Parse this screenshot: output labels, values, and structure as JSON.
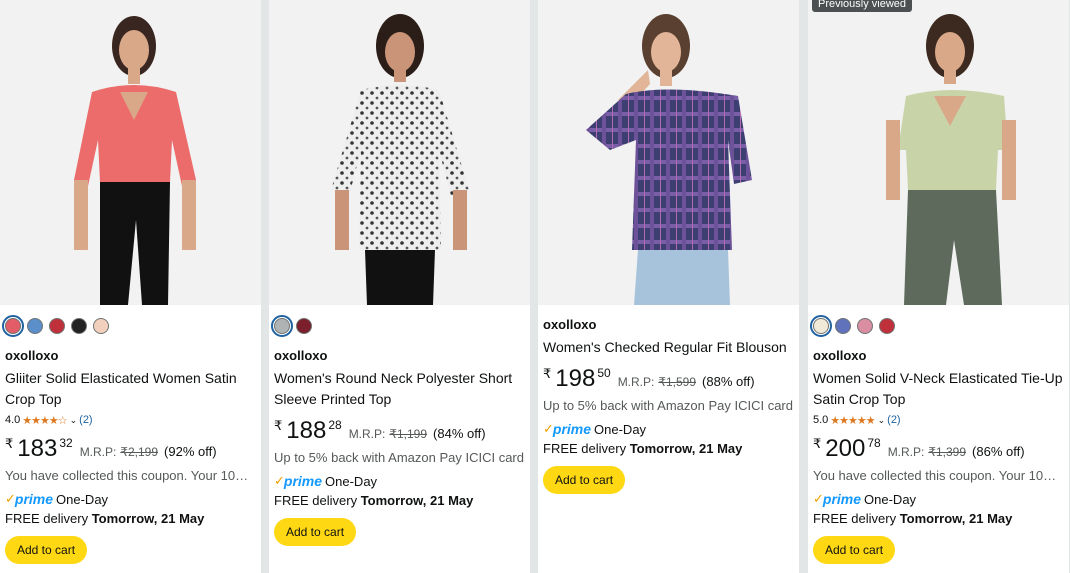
{
  "badge_previously_viewed": "Previously viewed",
  "products": [
    {
      "swatches": [
        "#e35d66",
        "#5b8fc9",
        "#c0303b",
        "#222222",
        "#f2d0bd"
      ],
      "brand": "oxolloxo",
      "title": "Gliiter Solid Elasticated Women Satin Crop Top",
      "rating": "4.0",
      "stars": "★★★★☆",
      "review_count": "(2)",
      "currency": "₹",
      "price_whole": "183",
      "price_fraction": "32",
      "mrp_label": "M.R.P:",
      "mrp": "₹2,199",
      "discount": "(92% off)",
      "note": "You have collected this coupon. Your 10%...",
      "prime_label": "prime",
      "prime_speed": "One-Day",
      "delivery_prefix": "FREE delivery",
      "delivery_date": "Tomorrow, 21 May",
      "button": "Add to cart"
    },
    {
      "swatches": [
        "#b0b3b3",
        "#7a1f2b"
      ],
      "brand": "oxolloxo",
      "title": "Women's Round Neck Polyester Short Sleeve Printed Top",
      "currency": "₹",
      "price_whole": "188",
      "price_fraction": "28",
      "mrp_label": "M.R.P:",
      "mrp": "₹1,199",
      "discount": "(84% off)",
      "note": "Up to 5% back with Amazon Pay ICICI card",
      "prime_label": "prime",
      "prime_speed": "One-Day",
      "delivery_prefix": "FREE delivery",
      "delivery_date": "Tomorrow, 21 May",
      "button": "Add to cart"
    },
    {
      "brand": "oxolloxo",
      "title": "Women's Checked Regular Fit Blouson",
      "currency": "₹",
      "price_whole": "198",
      "price_fraction": "50",
      "mrp_label": "M.R.P:",
      "mrp": "₹1,599",
      "discount": "(88% off)",
      "note": "Up to 5% back with Amazon Pay ICICI card",
      "prime_label": "prime",
      "prime_speed": "One-Day",
      "delivery_prefix": "FREE delivery",
      "delivery_date": "Tomorrow, 21 May",
      "button": "Add to cart"
    },
    {
      "swatches": [
        "#f1ead8",
        "#5f72bb",
        "#d98ea2",
        "#c0303b"
      ],
      "brand": "oxolloxo",
      "title": "Women Solid V-Neck Elasticated Tie-Up Satin Crop Top",
      "rating": "5.0",
      "stars": "★★★★★",
      "review_count": "(2)",
      "currency": "₹",
      "price_whole": "200",
      "price_fraction": "78",
      "mrp_label": "M.R.P:",
      "mrp": "₹1,399",
      "discount": "(86% off)",
      "note": "You have collected this coupon. Your 10%...",
      "prime_label": "prime",
      "prime_speed": "One-Day",
      "delivery_prefix": "FREE delivery",
      "delivery_date": "Tomorrow, 21 May",
      "button": "Add to cart"
    }
  ]
}
